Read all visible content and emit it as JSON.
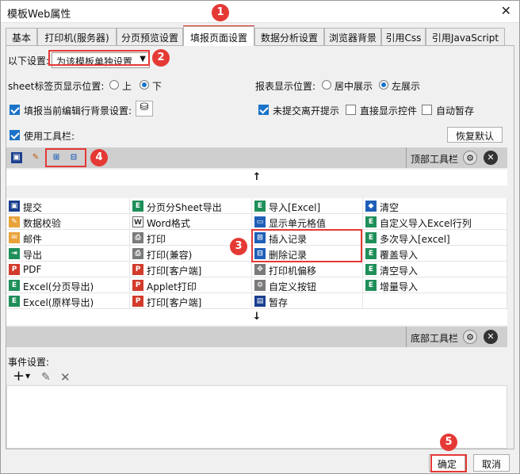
{
  "window": {
    "title": "模板Web属性",
    "close": "✕"
  },
  "tabs": [
    "基本",
    "打印机(服务器)",
    "分页预览设置",
    "填报页面设置",
    "数据分析设置",
    "浏览器背景",
    "引用Css",
    "引用JavaScript"
  ],
  "settings": {
    "scope_label": "以下设置:",
    "scope_value": "为该模板单独设置",
    "sheet_pos_label": "sheet标签页显示位置:",
    "sheet_top": "上",
    "sheet_bottom": "下",
    "report_pos_label": "报表显示位置:",
    "report_center": "居中展示",
    "report_left": "左展示",
    "fill_bg_label": "填报当前编辑行背景设置:",
    "unsaved_tip": "未提交离开提示",
    "direct_widget": "直接显示控件",
    "auto_save": "自动暂存",
    "use_toolbar": "使用工具栏:",
    "restore_default": "恢复默认"
  },
  "toolbar": {
    "top_label": "顶部工具栏",
    "bottom_label": "底部工具栏",
    "up_arrow": "↑",
    "down_arrow": "↓"
  },
  "buttons_grid": [
    [
      "提交",
      "分页分Sheet导出",
      "导入[Excel]",
      "清空"
    ],
    [
      "数据校验",
      "Word格式",
      "显示单元格值",
      "自定义导入Excel行列"
    ],
    [
      "邮件",
      "打印",
      "插入记录",
      "多次导入[excel]"
    ],
    [
      "导出",
      "打印(兼容)",
      "删除记录",
      "覆盖导入"
    ],
    [
      "PDF",
      "打印[客户端]",
      "打印机偏移",
      "清空导入"
    ],
    [
      "Excel(分页导出)",
      "Applet打印",
      "自定义按钮",
      "增量导入"
    ],
    [
      "Excel(原样导出)",
      "打印[客户端]",
      "暂存",
      ""
    ]
  ],
  "grid_icons": [
    [
      "save-icon",
      "excel-icon",
      "excel-icon",
      "eraser-icon"
    ],
    [
      "check-pen-icon",
      "word-icon",
      "cell-icon",
      "excel-icon"
    ],
    [
      "mail-icon",
      "printer-icon",
      "insert-row-icon",
      "excel-icon"
    ],
    [
      "export-icon",
      "printer-icon",
      "delete-row-icon",
      "excel-icon"
    ],
    [
      "pdf-icon",
      "pdf-icon",
      "move-icon",
      "excel-icon"
    ],
    [
      "excel-icon",
      "pdf-icon",
      "gear-icon",
      "excel-icon"
    ],
    [
      "excel-icon",
      "pdf-icon",
      "disk-icon",
      ""
    ]
  ],
  "icon_glyphs": {
    "save-icon": "▣",
    "excel-icon": "E",
    "eraser-icon": "◆",
    "check-pen-icon": "✎",
    "word-icon": "W",
    "cell-icon": "▭",
    "mail-icon": "✉",
    "printer-icon": "⎙",
    "insert-row-icon": "⊞",
    "delete-row-icon": "⊟",
    "export-icon": "⇥",
    "pdf-icon": "P",
    "move-icon": "✥",
    "gear-icon": "⚙",
    "disk-icon": "▤"
  },
  "events": {
    "label": "事件设置:",
    "add": "+",
    "edit": "✎",
    "delete": "✕"
  },
  "footer": {
    "ok": "确定",
    "cancel": "取消"
  },
  "badges": {
    "b1": "1",
    "b2": "2",
    "b3": "3",
    "b4": "4",
    "b5": "5"
  },
  "colors": {
    "accent": "#1a73c8",
    "annotation": "#e53935",
    "toolbar_bar": "#cfcfcf"
  }
}
